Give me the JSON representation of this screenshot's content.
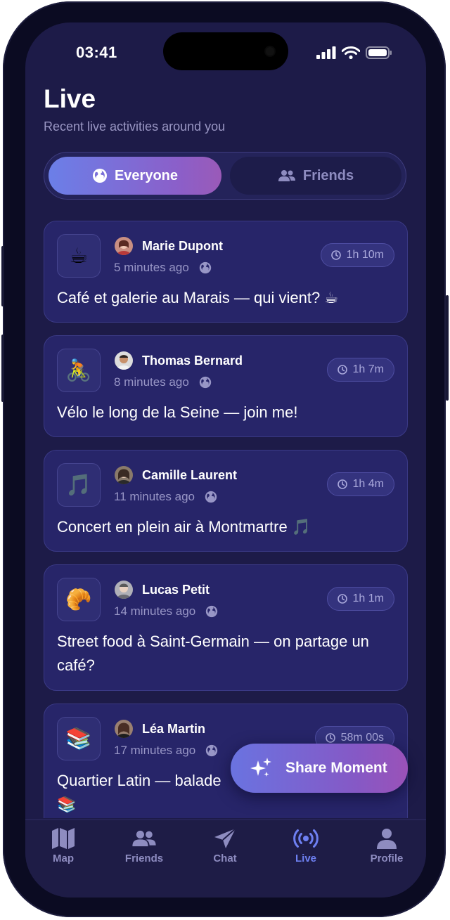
{
  "status_bar": {
    "time": "03:41"
  },
  "header": {
    "title": "Live",
    "subtitle": "Recent live activities around you"
  },
  "segments": {
    "everyone": "Everyone",
    "friends": "Friends"
  },
  "feed": [
    {
      "emoji": "☕",
      "name": "Marie Dupont",
      "time_ago": "5 minutes ago",
      "duration": "1h 10m",
      "text": "Café et galerie au Marais — qui vient? ☕"
    },
    {
      "emoji": "🚴",
      "name": "Thomas Bernard",
      "time_ago": "8 minutes ago",
      "duration": "1h 7m",
      "text": "Vélo le long de la Seine — join me!"
    },
    {
      "emoji": "🎵",
      "name": "Camille Laurent",
      "time_ago": "11 minutes ago",
      "duration": "1h 4m",
      "text": "Concert en plein air à Montmartre 🎵"
    },
    {
      "emoji": "🥐",
      "name": "Lucas Petit",
      "time_ago": "14 minutes ago",
      "duration": "1h 1m",
      "text": "Street food à Saint-Germain — on partage un café?"
    },
    {
      "emoji": "📚",
      "name": "Léa Martin",
      "time_ago": "17 minutes ago",
      "duration": "58m 00s",
      "text": "Quartier Latin — balade 📚"
    }
  ],
  "fab": {
    "label": "Share Moment"
  },
  "tabs": [
    {
      "label": "Map"
    },
    {
      "label": "Friends"
    },
    {
      "label": "Chat"
    },
    {
      "label": "Live"
    },
    {
      "label": "Profile"
    }
  ],
  "colors": {
    "accent": "#6e80f2",
    "background": "#1d1b48",
    "card": "#272569"
  }
}
